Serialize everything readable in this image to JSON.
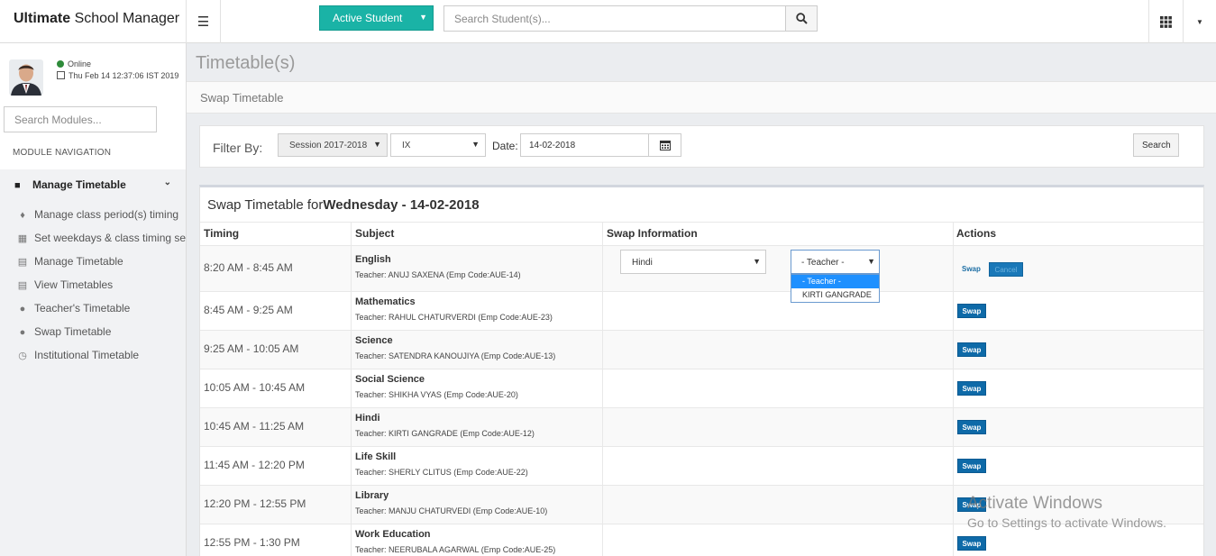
{
  "app": {
    "brand_bold": "Ultimate",
    "brand_rest": " School Manager"
  },
  "topbar": {
    "active_student_label": "Active Student",
    "search_placeholder": "Search Student(s)..."
  },
  "sidebar": {
    "status": "Online",
    "datetime": "Thu Feb 14 12:37:06 IST 2019",
    "search_placeholder": "Search Modules...",
    "module_nav_label": "MODULE NAVIGATION",
    "menu_head": "Manage Timetable",
    "items": [
      {
        "label": "Manage class period(s) timing",
        "icon": "bell-icon"
      },
      {
        "label": "Set weekdays & class timing sets",
        "icon": "calendar-icon"
      },
      {
        "label": "Manage Timetable",
        "icon": "calendar-plus-icon"
      },
      {
        "label": "View Timetables",
        "icon": "calendar-icon"
      },
      {
        "label": "Teacher's Timetable",
        "icon": "user-icon"
      },
      {
        "label": "Swap Timetable",
        "icon": "user-icon"
      },
      {
        "label": "Institutional Timetable",
        "icon": "clock-icon"
      }
    ]
  },
  "main": {
    "page_title": "Timetable(s)",
    "breadcrumb": "Swap Timetable",
    "filter": {
      "label": "Filter By:",
      "session": "Session 2017-2018",
      "class": "IX",
      "date_label": "Date:",
      "date_value": "14-02-2018",
      "search_label": "Search"
    },
    "panel": {
      "title_prefix": "Swap Timetable for",
      "title_day": "Wednesday - 14-02-2018",
      "headers": [
        "Timing",
        "Subject",
        "Swap Information",
        "Actions"
      ],
      "swap_subject": "Hindi",
      "swap_teacher": "- Teacher -",
      "teacher_options": [
        "- Teacher -",
        "KIRTI GANGRADE"
      ],
      "swap_label": "Swap",
      "cancel_label": "Cancel",
      "rows": [
        {
          "timing": "8:20 AM - 8:45 AM",
          "subject": "English",
          "teacher": "Teacher: ANUJ SAXENA (Emp Code:AUE-14)"
        },
        {
          "timing": "8:45 AM - 9:25 AM",
          "subject": "Mathematics",
          "teacher": "Teacher: RAHUL CHATURVERDI (Emp Code:AUE-23)"
        },
        {
          "timing": "9:25 AM - 10:05 AM",
          "subject": "Science",
          "teacher": "Teacher: SATENDRA KANOUJIYA (Emp Code:AUE-13)"
        },
        {
          "timing": "10:05 AM - 10:45 AM",
          "subject": "Social Science",
          "teacher": "Teacher: SHIKHA VYAS (Emp Code:AUE-20)"
        },
        {
          "timing": "10:45 AM - 11:25 AM",
          "subject": "Hindi",
          "teacher": "Teacher: KIRTI GANGRADE (Emp Code:AUE-12)"
        },
        {
          "timing": "11:45 AM - 12:20 PM",
          "subject": "Life Skill",
          "teacher": "Teacher: SHERLY CLITUS (Emp Code:AUE-22)"
        },
        {
          "timing": "12:20 PM - 12:55 PM",
          "subject": "Library",
          "teacher": "Teacher: MANJU CHATURVEDI (Emp Code:AUE-10)"
        },
        {
          "timing": "12:55 PM - 1:30 PM",
          "subject": "Work Education",
          "teacher": "Teacher: NEERUBALA AGARWAL (Emp Code:AUE-25)"
        }
      ]
    }
  },
  "watermark": {
    "line1": "Activate Windows",
    "line2": "Go to Settings to activate Windows."
  }
}
